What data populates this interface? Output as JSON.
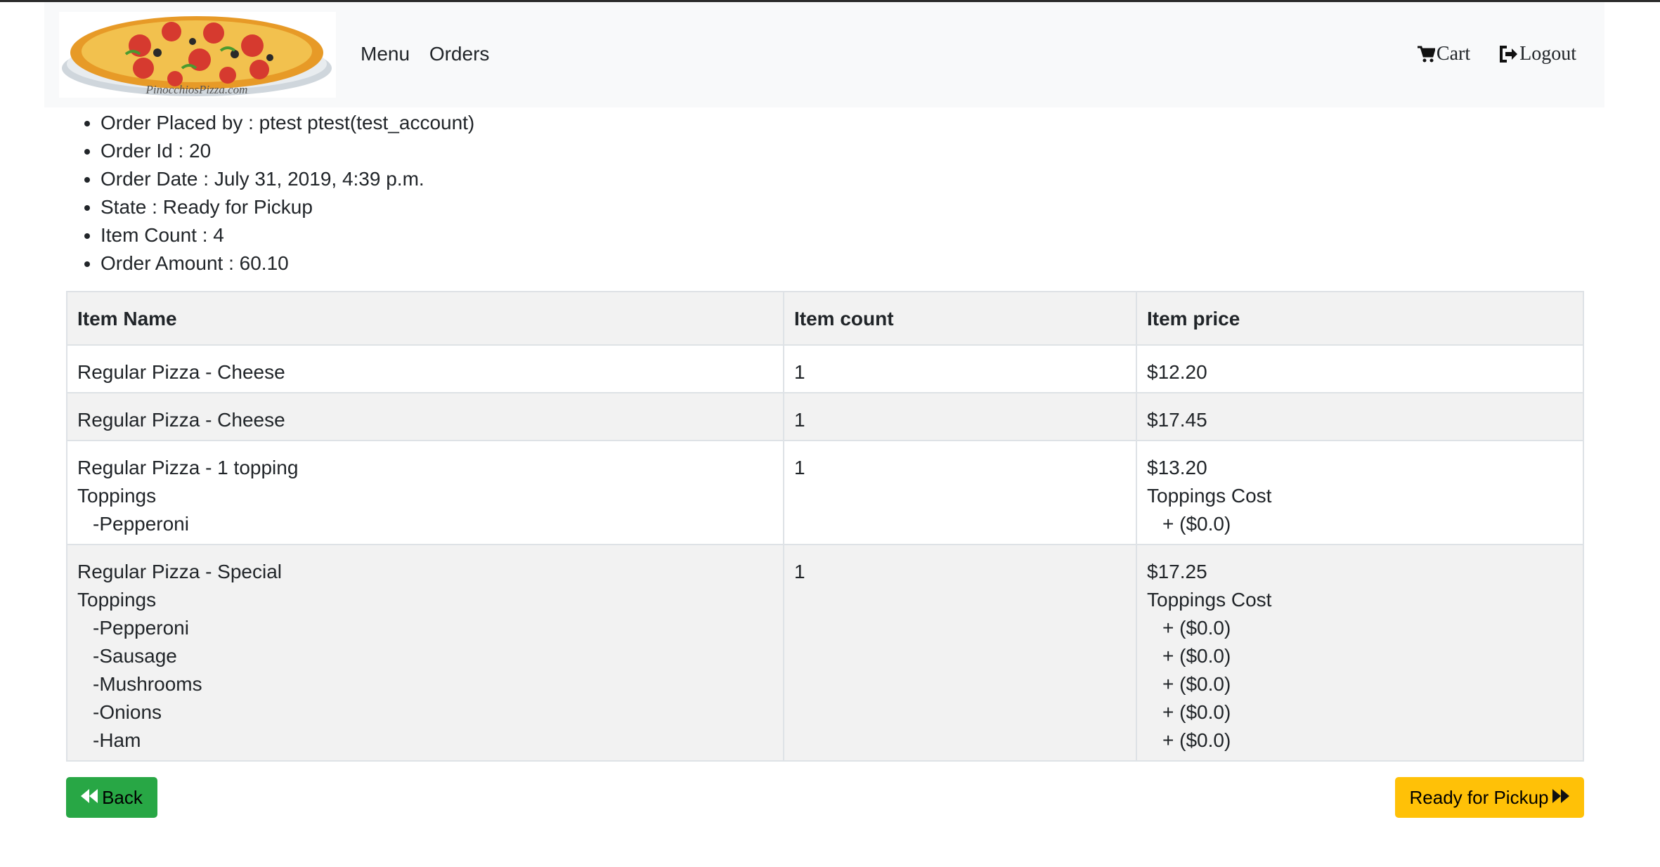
{
  "nav": {
    "logo_text": "PinocchiosPizza.com",
    "links": [
      "Menu",
      "Orders"
    ],
    "cart_label": "Cart",
    "logout_label": "Logout"
  },
  "order": {
    "details": [
      "Order Placed by : ptest ptest(test_account)",
      "Order Id : 20",
      "Order Date : July 31, 2019, 4:39 p.m.",
      "State : Ready for Pickup",
      "Item Count : 4",
      "Order Amount : 60.10"
    ]
  },
  "table": {
    "headers": [
      "Item Name",
      "Item count",
      "Item price"
    ],
    "toppings_label": "Toppings",
    "toppings_cost_label": "Toppings Cost",
    "rows": [
      {
        "name": "Regular Pizza - Cheese",
        "count": "1",
        "price": "$12.20",
        "toppings": [],
        "topping_costs": []
      },
      {
        "name": "Regular Pizza - Cheese",
        "count": "1",
        "price": "$17.45",
        "toppings": [],
        "topping_costs": []
      },
      {
        "name": "Regular Pizza - 1 topping",
        "count": "1",
        "price": "$13.20",
        "toppings": [
          "-Pepperoni"
        ],
        "topping_costs": [
          "+ ($0.0)"
        ]
      },
      {
        "name": "Regular Pizza - Special",
        "count": "1",
        "price": "$17.25",
        "toppings": [
          "-Pepperoni",
          "-Sausage",
          "-Mushrooms",
          "-Onions",
          "-Ham"
        ],
        "topping_costs": [
          "+ ($0.0)",
          "+ ($0.0)",
          "+ ($0.0)",
          "+ ($0.0)",
          "+ ($0.0)"
        ]
      }
    ]
  },
  "buttons": {
    "back_label": "Back",
    "ready_label": "Ready for Pickup"
  },
  "colors": {
    "back_button": "#28a745",
    "ready_button": "#ffc107",
    "navbar_bg": "#f8f9fa",
    "table_stripe": "#f2f2f2"
  },
  "icons": {
    "cart": "cart-icon",
    "logout": "logout-icon",
    "back": "fast-backward-icon",
    "forward": "fast-forward-icon"
  }
}
